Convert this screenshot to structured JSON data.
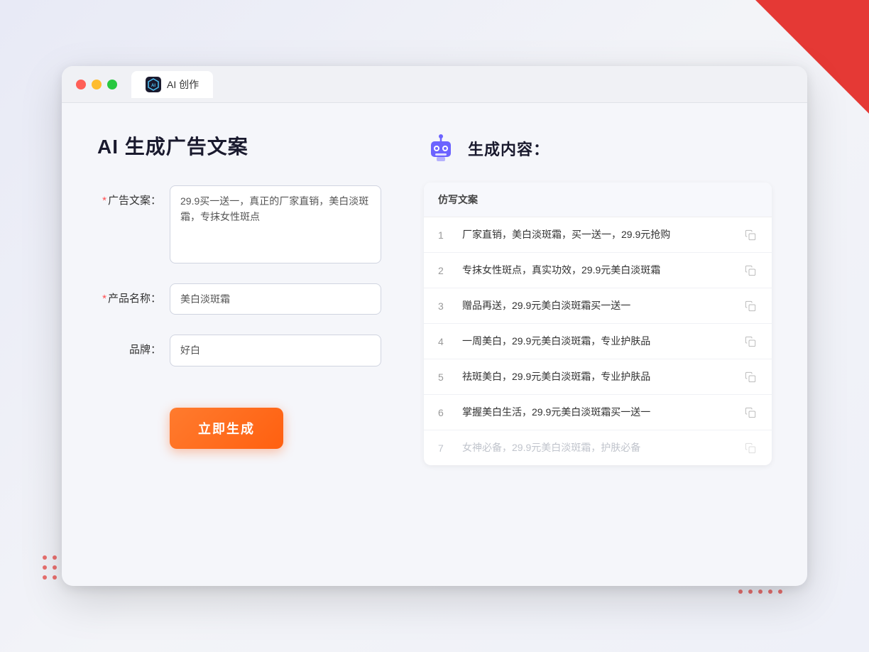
{
  "window": {
    "tab_label": "AI 创作",
    "tab_icon": "AI"
  },
  "left_panel": {
    "title": "AI 生成广告文案",
    "fields": [
      {
        "label": "广告文案：",
        "required": true,
        "type": "textarea",
        "value": "29.9买一送一，真正的厂家直销，美白淡斑霜，专抹女性斑点",
        "name": "ad-copy-textarea"
      },
      {
        "label": "产品名称：",
        "required": true,
        "type": "input",
        "value": "美白淡斑霜",
        "name": "product-name-input"
      },
      {
        "label": "品牌：",
        "required": false,
        "type": "input",
        "value": "好白",
        "name": "brand-input"
      }
    ],
    "button_label": "立即生成"
  },
  "right_panel": {
    "title": "生成内容：",
    "table_header": "仿写文案",
    "rows": [
      {
        "num": "1",
        "text": "厂家直销，美白淡斑霜，买一送一，29.9元抢购",
        "faded": false
      },
      {
        "num": "2",
        "text": "专抹女性斑点，真实功效，29.9元美白淡斑霜",
        "faded": false
      },
      {
        "num": "3",
        "text": "赠品再送，29.9元美白淡斑霜买一送一",
        "faded": false
      },
      {
        "num": "4",
        "text": "一周美白，29.9元美白淡斑霜，专业护肤品",
        "faded": false
      },
      {
        "num": "5",
        "text": "祛斑美白，29.9元美白淡斑霜，专业护肤品",
        "faded": false
      },
      {
        "num": "6",
        "text": "掌握美白生活，29.9元美白淡斑霜买一送一",
        "faded": false
      },
      {
        "num": "7",
        "text": "女神必备，29.9元美白淡斑霜，护肤必备",
        "faded": true
      }
    ]
  },
  "decorations": {
    "dots_count": 15,
    "accent_color": "#e53935"
  }
}
